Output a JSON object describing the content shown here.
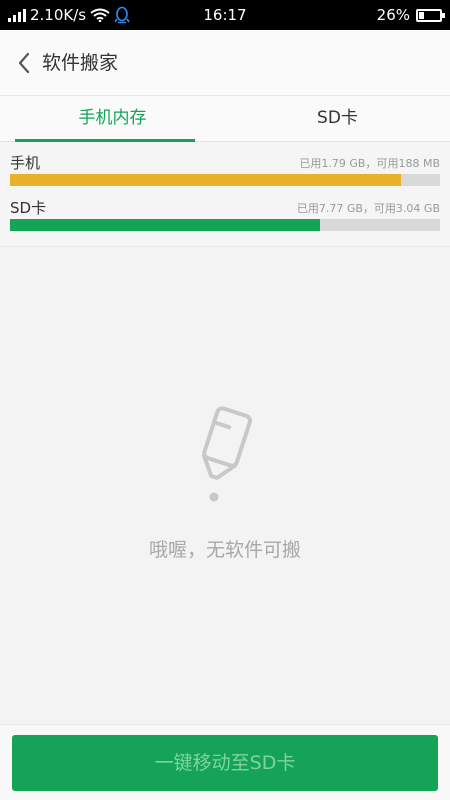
{
  "status_bar": {
    "speed": "2.10K/s",
    "time": "16:17",
    "battery": "26%",
    "battery_level": 0.26
  },
  "header": {
    "title": "软件搬家"
  },
  "tabs": [
    {
      "label": "手机内存",
      "active": true
    },
    {
      "label": "SD卡",
      "active": false
    }
  ],
  "storage": [
    {
      "label": "手机",
      "info": "已用1.79 GB，可用188 MB",
      "used_fraction": 0.91,
      "color": "#e9b127"
    },
    {
      "label": "SD卡",
      "info": "已用7.77 GB，可用3.04 GB",
      "used_fraction": 0.72,
      "color": "#14a357"
    }
  ],
  "empty_state": {
    "icon": "empty-bottle-icon",
    "text": "哦喔，无软件可搬"
  },
  "bottom_button": {
    "label": "一键移动至SD卡"
  },
  "colors": {
    "accent": "#14a357",
    "phone_bar": "#e9b127",
    "track": "#d9d9d9"
  }
}
